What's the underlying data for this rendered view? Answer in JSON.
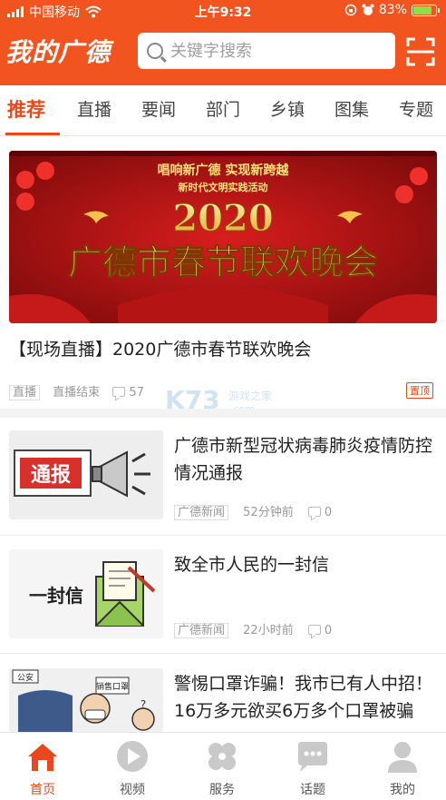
{
  "status_bar": {
    "carrier": "中国移动",
    "time": "上午9:32",
    "battery": "83%"
  },
  "header": {
    "logo": "我的广德",
    "search_placeholder": "关键字搜索"
  },
  "tabs": [
    "推荐",
    "直播",
    "要闻",
    "部门",
    "乡镇",
    "图集",
    "专题"
  ],
  "featured": {
    "banner_top_text": "唱响新广德 实现新跨越",
    "banner_sub_text": "新时代文明实践活动",
    "banner_year": "2020",
    "banner_main_text": "广德市春节联欢晚会",
    "title": "【现场直播】2020广德市春节联欢晚会",
    "tag": "直播",
    "status": "直播结束",
    "comments": "57",
    "pin": "置顶"
  },
  "watermark": {
    "brand": "K73",
    "site": "游戏之家",
    "domain": ".com"
  },
  "news": [
    {
      "title": "广德市新型冠状病毒肺炎疫情防控情况通报",
      "thumb_text": "通报",
      "source": "广德新闻",
      "time": "52分钟前",
      "comments": "0"
    },
    {
      "title": "致全市人民的一封信",
      "thumb_text": "一封信",
      "source": "广德新闻",
      "time": "22小时前",
      "comments": "0"
    },
    {
      "title": "警惕口罩诈骗！我市已有人中招！16万多元欲买6万多个口罩被骗",
      "thumb_text_1": "公安",
      "thumb_text_2": "销售口罩"
    }
  ],
  "tabbar": [
    {
      "label": "首页",
      "icon": "home-icon"
    },
    {
      "label": "视频",
      "icon": "play-icon"
    },
    {
      "label": "服务",
      "icon": "clover-icon"
    },
    {
      "label": "话题",
      "icon": "chat-icon"
    },
    {
      "label": "我的",
      "icon": "user-icon"
    }
  ],
  "colors": {
    "brand": "#f2541f",
    "accent": "#e8481c",
    "tabbar_inactive": "#c9c9c9"
  }
}
